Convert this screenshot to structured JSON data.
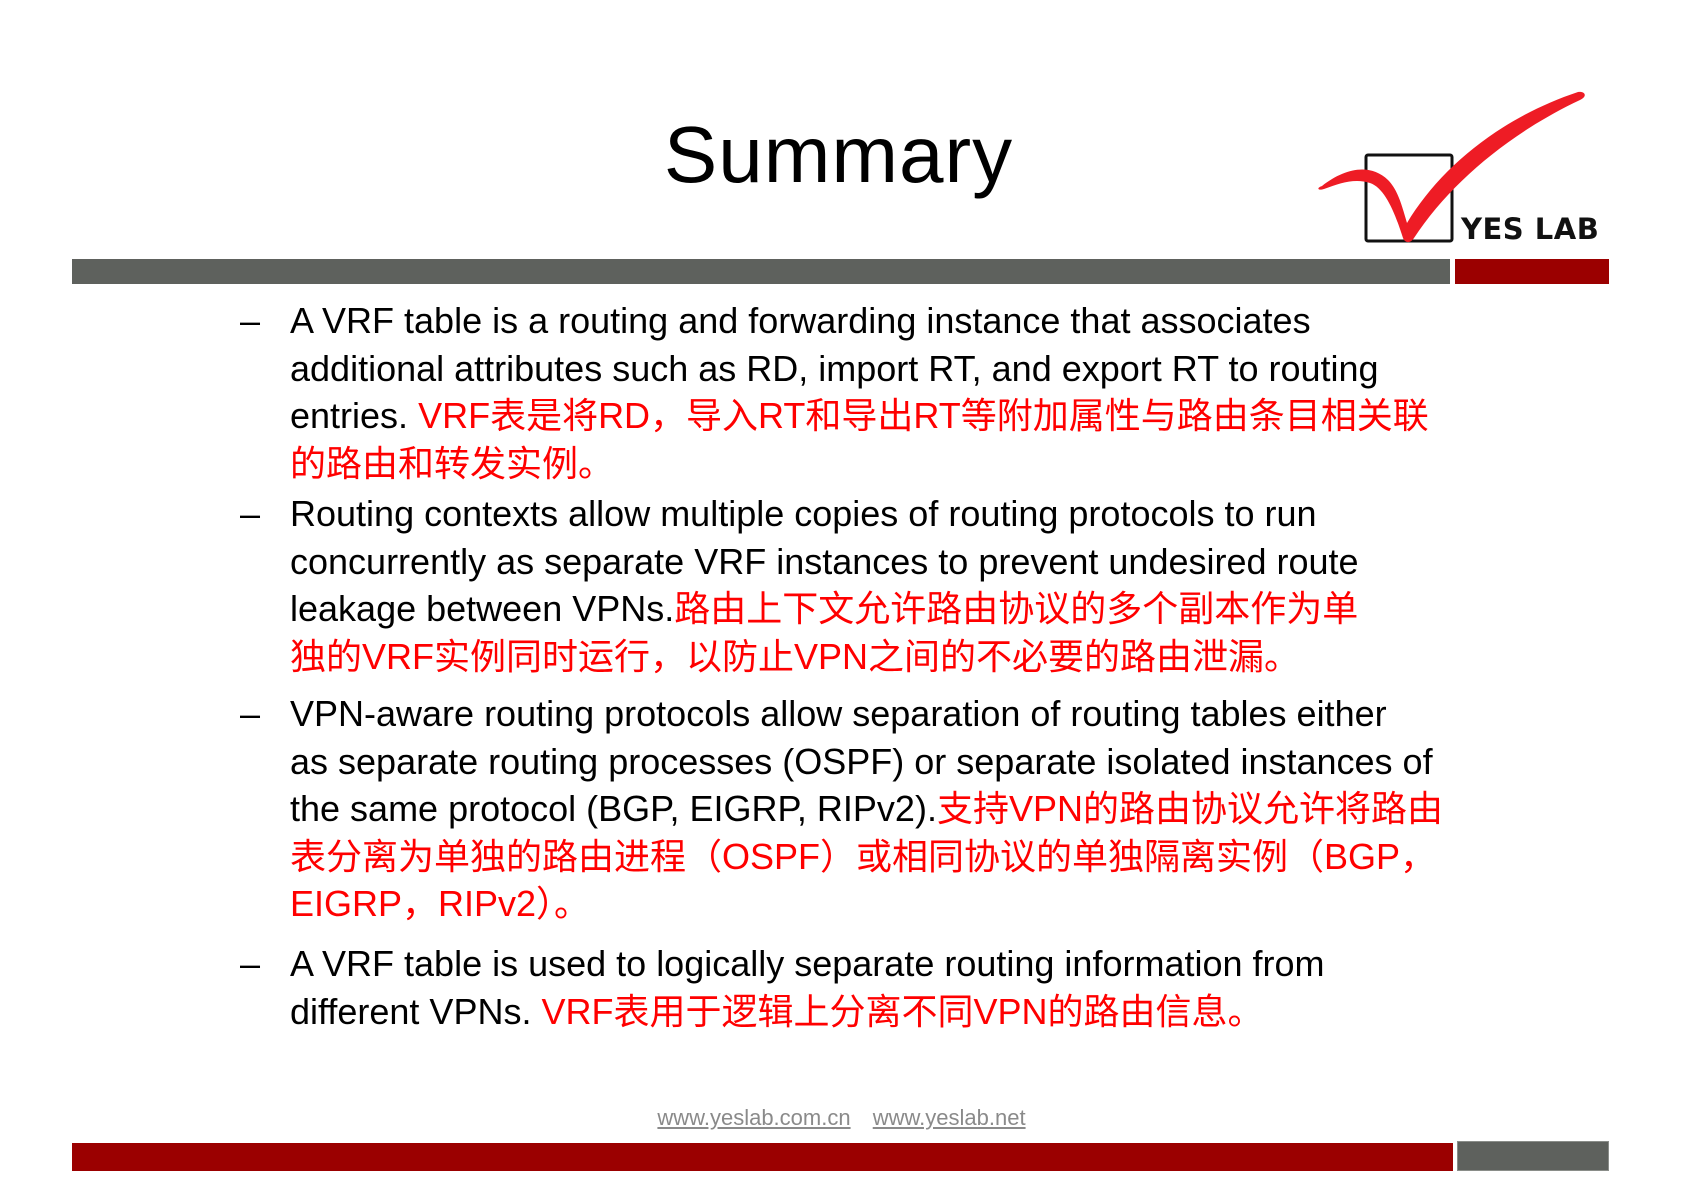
{
  "slide": {
    "title": "Summary",
    "brand": {
      "logo_text": "YES LAB",
      "logo_icon": "checkmark-in-box-icon",
      "colors": {
        "accent_red": "#9b0000",
        "bar_gray": "#5e615d",
        "check_red": "#ee1c25",
        "translation_red": "#ff0000"
      }
    },
    "bullets": [
      {
        "marker": "–",
        "lines": [
          {
            "en": "A VRF table is a routing and forwarding instance that associates",
            "cn": ""
          },
          {
            "en": "additional attributes such as RD, import RT, and export RT to routing",
            "cn": ""
          },
          {
            "en": "entries. ",
            "cn": "VRF表是将RD，导入RT和导出RT等附加属性与路由条目相关联"
          },
          {
            "en": "",
            "cn": "的路由和转发实例。"
          }
        ]
      },
      {
        "marker": "–",
        "lines": [
          {
            "en": "Routing contexts allow multiple copies of routing protocols to run",
            "cn": ""
          },
          {
            "en": "concurrently as separate VRF instances to prevent undesired route",
            "cn": ""
          },
          {
            "en": "leakage between VPNs.",
            "cn": "路由上下文允许路由协议的多个副本作为单"
          },
          {
            "en": "",
            "cn": "独的VRF实例同时运行，以防止VPN之间的不必要的路由泄漏。"
          }
        ]
      },
      {
        "marker": "–",
        "lines": [
          {
            "en": "VPN-aware routing protocols allow separation of routing tables either",
            "cn": ""
          },
          {
            "en": "as separate routing processes (OSPF) or separate isolated instances of",
            "cn": ""
          },
          {
            "en": "the same protocol (BGP, EIGRP, RIPv2).",
            "cn": "支持VPN的路由协议允许将路由"
          },
          {
            "en": "",
            "cn": "表分离为单独的路由进程（OSPF）或相同协议的单独隔离实例（BGP，"
          },
          {
            "en": "",
            "cn": "EIGRP，RIPv2）。"
          }
        ]
      },
      {
        "marker": "–",
        "lines": [
          {
            "en": "A VRF table is used to logically separate routing information from",
            "cn": ""
          },
          {
            "en": "different VPNs. ",
            "cn": "VRF表用于逻辑上分离不同VPN的路由信息。"
          }
        ]
      }
    ],
    "footer": {
      "links": [
        "www.yeslab.com.cn",
        "www.yeslab.net"
      ]
    }
  }
}
